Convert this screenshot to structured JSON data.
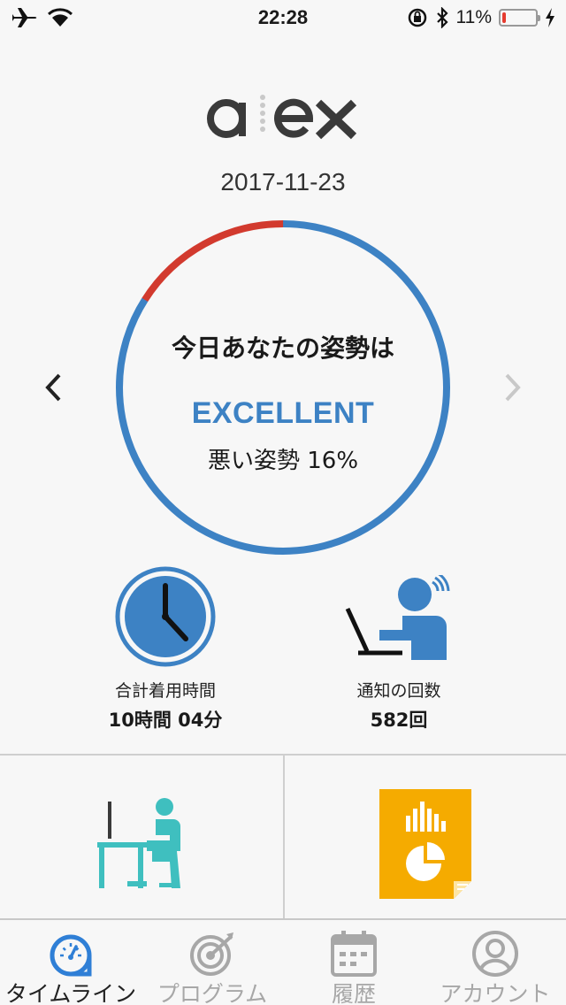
{
  "status_bar": {
    "time": "22:28",
    "battery_text": "11%",
    "battery_level": 0.11,
    "battery_color": "#e53b2f"
  },
  "header": {
    "logo_text": "alex",
    "date": "2017-11-23"
  },
  "posture": {
    "title": "今日あなたの姿勢は",
    "rating": "EXCELLENT",
    "bad_posture_text": "悪い姿勢 16%",
    "bad_posture_fraction": 0.16,
    "good_color": "#3d82c4",
    "bad_color": "#d23a2e"
  },
  "stats": {
    "wear_time": {
      "label": "合計着用時間",
      "value": "10時間 04分",
      "icon": "clock-icon"
    },
    "notifications": {
      "label": "通知の回数",
      "value": "582回",
      "icon": "person-laptop-icon"
    }
  },
  "tiles": {
    "program": {
      "icon": "desk-posture-icon",
      "color": "#3fbfbf"
    },
    "report": {
      "icon": "report-chart-icon",
      "color": "#f5ab00"
    }
  },
  "tabs": [
    {
      "label": "タイムライン",
      "icon": "gauge-icon",
      "active": true
    },
    {
      "label": "プログラム",
      "icon": "target-icon",
      "active": false
    },
    {
      "label": "履歴",
      "icon": "calendar-icon",
      "active": false
    },
    {
      "label": "アカウント",
      "icon": "account-icon",
      "active": false
    }
  ]
}
